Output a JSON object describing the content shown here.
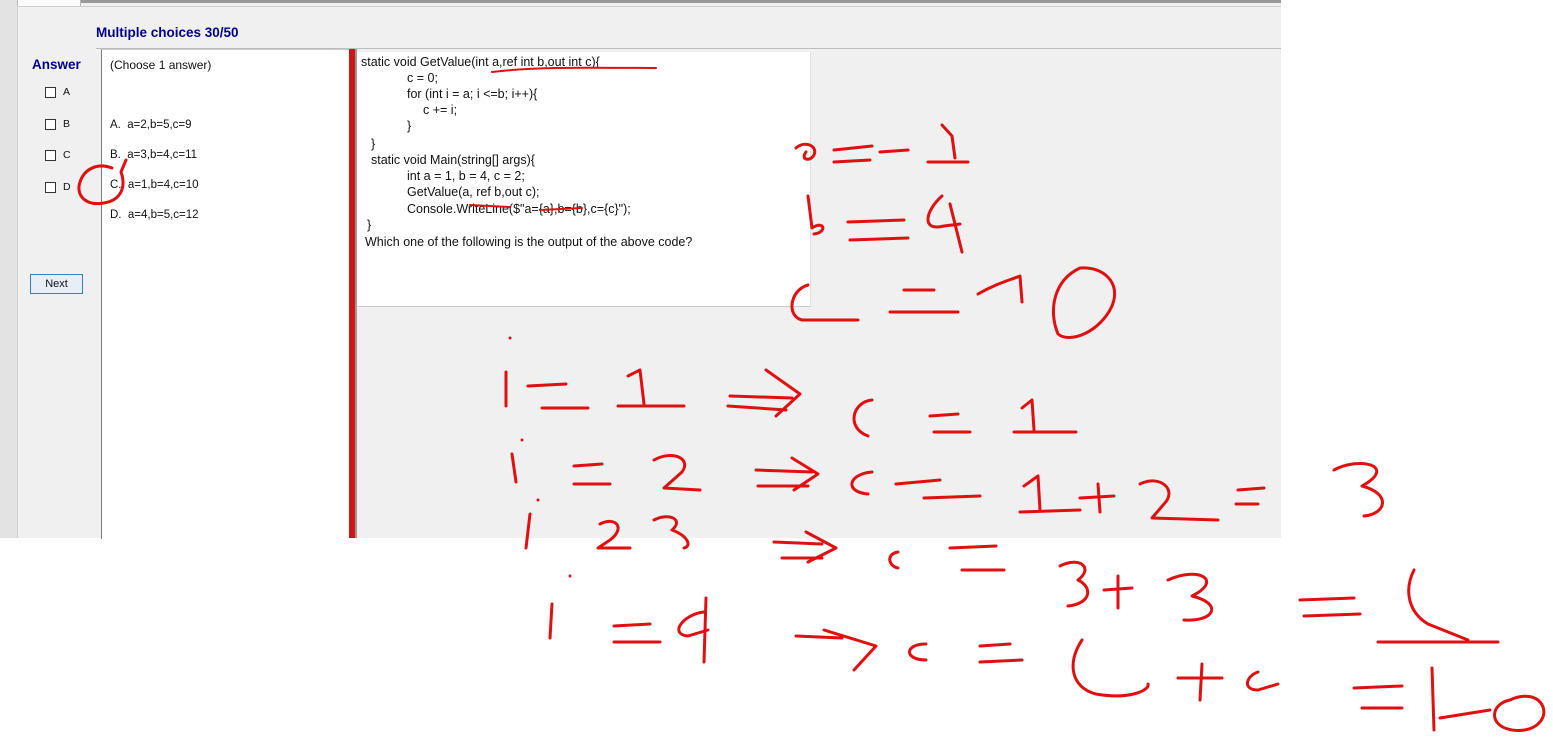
{
  "header": {
    "question_count": "Multiple choices 30/50"
  },
  "answer_panel": {
    "title": "Answer",
    "choices": [
      "A",
      "B",
      "C",
      "D"
    ],
    "next_label": "Next"
  },
  "options_panel": {
    "hint": "(Choose 1 answer)",
    "options": [
      "A.  a=2,b=5,c=9",
      "B.  a=3,b=4,c=11",
      "C.  a=1,b=4,c=10",
      "D.  a=4,b=5,c=12"
    ]
  },
  "question": {
    "code_lines": [
      "static void GetValue(int a,ref int b,out int c){",
      "c = 0;",
      "for (int i = a; i <=b; i++){",
      "c += i;",
      "}",
      "}",
      "static void Main(string[] args){",
      "int a = 1, b = 4, c = 2;",
      "GetValue(a, ref b,out c);",
      "Console.WriteLine($\"a={a},b={b},c={c}\");",
      "}"
    ],
    "prompt": "Which one of the following is the output of the above code?"
  },
  "colors": {
    "title_blue": "#00008b",
    "accent_red": "#cc1818",
    "ink_red": "#e01010",
    "button_border": "#2d7fd0"
  }
}
